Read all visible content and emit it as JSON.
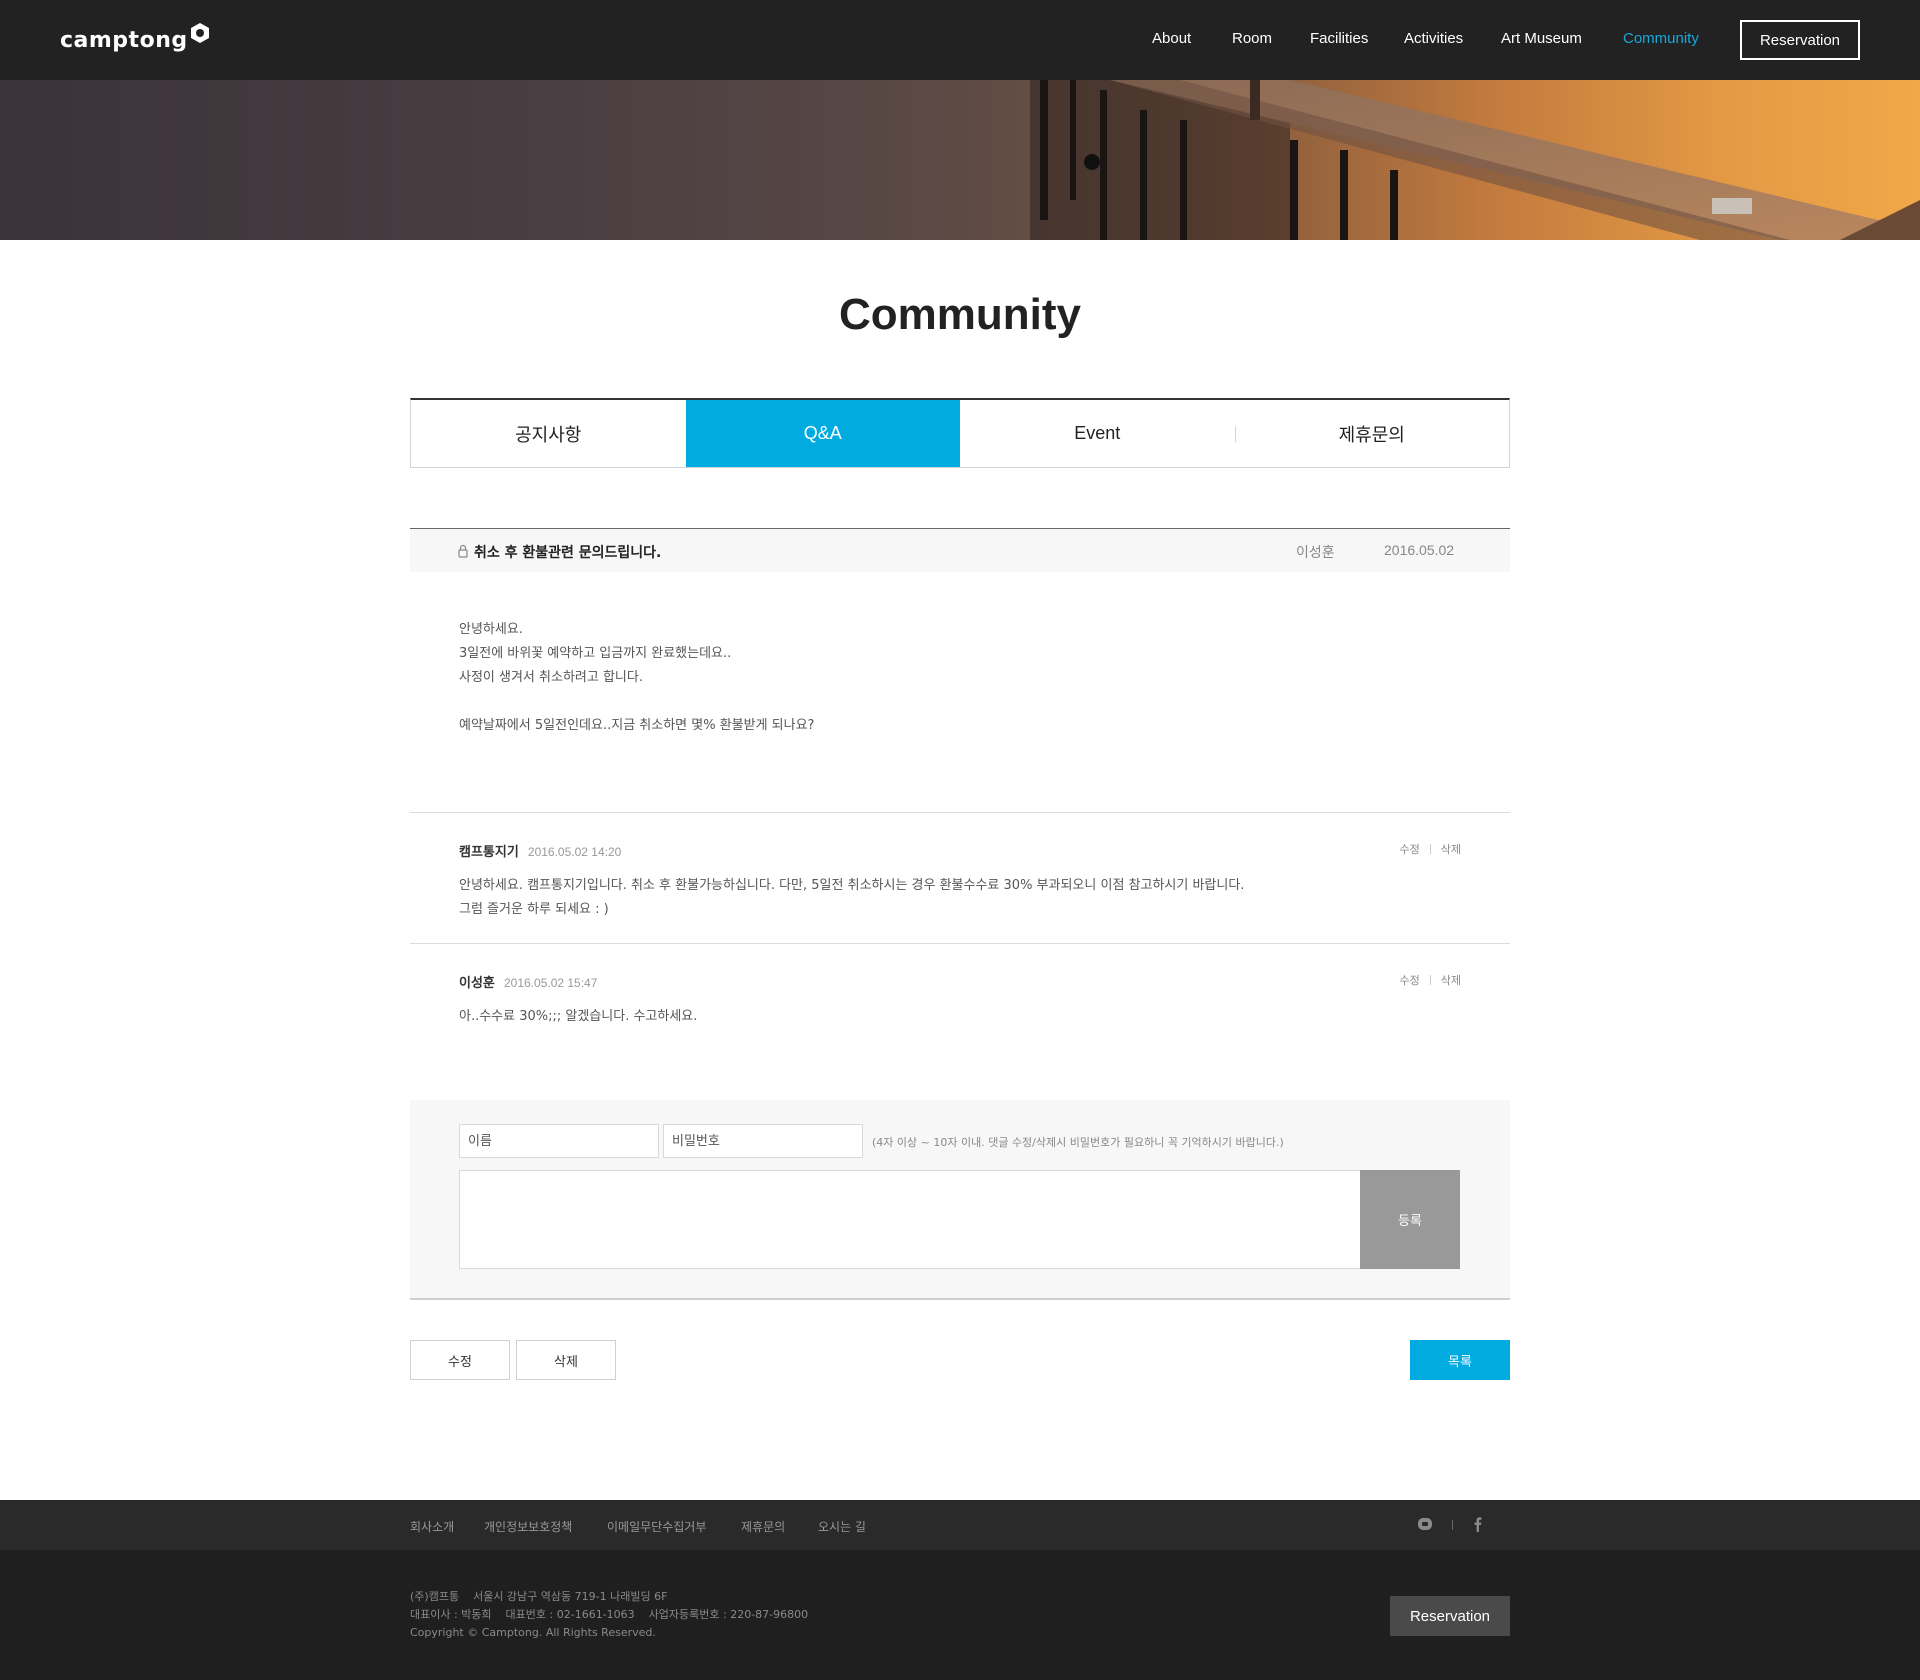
{
  "header": {
    "logo": "camptong",
    "nav": [
      "About",
      "Room",
      "Facilities",
      "Activities",
      "Art Museum",
      "Community"
    ],
    "active_nav": "Community",
    "reservation": "Reservation"
  },
  "page": {
    "title": "Community"
  },
  "tabs": [
    {
      "label": "공지사항"
    },
    {
      "label": "Q&A"
    },
    {
      "label": "Event"
    },
    {
      "label": "제휴문의"
    }
  ],
  "active_tab": "Q&A",
  "post": {
    "title": "취소 후 환불관련 문의드립니다.",
    "author": "이성훈",
    "date": "2016.05.02",
    "body": [
      "안녕하세요.",
      "3일전에 바위꽃 예약하고 입금까지 완료했는데요..",
      "사정이 생겨서 취소하려고 합니다.",
      "",
      "예약날짜에서 5일전인데요..지금 취소하면 몇% 환불받게 되나요?"
    ]
  },
  "comments": [
    {
      "author": "캠프통지기",
      "time": "2016.05.02 14:20",
      "edit": "수정",
      "delete": "삭제",
      "lines": [
        "안녕하세요. 캠프통지기입니다. 취소 후 환불가능하십니다. 다만, 5일전 취소하시는 경우 환불수수료 30% 부과되오니 이점 참고하시기 바랍니다.",
        "그럼 즐거운 하루 되세요 : )"
      ]
    },
    {
      "author": "이성훈",
      "time": "2016.05.02 15:47",
      "edit": "수정",
      "delete": "삭제",
      "lines": [
        "아..수수료 30%;;; 알겠습니다. 수고하세요."
      ]
    }
  ],
  "comment_form": {
    "name_placeholder": "이름",
    "password_placeholder": "비밀번호",
    "note": "(4자 이상 ~ 10자 이내. 댓글 수정/삭제시 비밀번호가 필요하니 꼭 기억하시기 바랍니다.)",
    "submit": "등록"
  },
  "buttons": {
    "edit": "수정",
    "delete": "삭제",
    "list": "목록"
  },
  "footer": {
    "links": [
      "회사소개",
      "개인정보보호정책",
      "이메일무단수집거부",
      "제휴문의",
      "오시는 길"
    ],
    "company": "(주)캠프통",
    "address": "서울시 강남구 역삼동 719-1 나래빌딩 6F",
    "ceo": "대표이사 : 박동희",
    "phone": "대표번호 : 02-1661-1063",
    "biz_no": "사업자등록번호 : 220-87-96800",
    "copyright": "Copyright © Camptong. All Rights Reserved.",
    "reservation": "Reservation",
    "social_icons": [
      "blog-icon",
      "facebook-icon"
    ]
  },
  "colors": {
    "accent": "#00abe0",
    "header_bg": "#222222",
    "footer_bg": "#1f1f1f"
  }
}
